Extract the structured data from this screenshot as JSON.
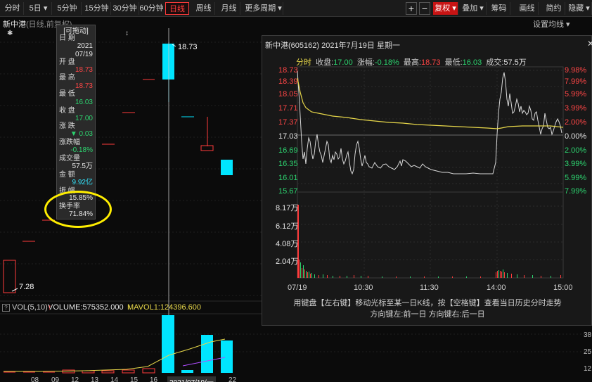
{
  "toolbar": {
    "items": [
      "分时",
      "5日",
      "5分钟",
      "15分钟",
      "30分钟",
      "60分钟",
      "日线",
      "周线",
      "月线",
      "更多周期"
    ],
    "plus": "+",
    "minus": "−",
    "right_items": [
      "复权",
      "叠加",
      "筹码",
      "画线",
      "简约",
      "隐藏"
    ],
    "active_item": "日线"
  },
  "stock": {
    "name": "新中港",
    "subtitle": "(日线,前复权)"
  },
  "setting_label": "设置均线",
  "info_box": {
    "header": "[可拖动]",
    "rows": [
      {
        "label": "日  期",
        "value": "2021\n07/19"
      },
      {
        "label": "开  盘",
        "value": "18.73"
      },
      {
        "label": "最  高",
        "value": "18.73"
      },
      {
        "label": "最  低",
        "value": "16.03"
      },
      {
        "label": "收  盘",
        "value": "17.00"
      },
      {
        "label": "涨  跌",
        "value": "▼ 0.03"
      },
      {
        "label": "涨跌幅",
        "value": "-0.18%"
      },
      {
        "label": "成交量",
        "value": "57.5万"
      },
      {
        "label": "金  额",
        "value": "9.92亿"
      },
      {
        "label": "振  幅",
        "value": "15.85%"
      },
      {
        "label": "换手率",
        "value": "71.84%"
      }
    ]
  },
  "price_labels": {
    "high": "18.73",
    "low": "7.28"
  },
  "marks": {
    "star": "✱",
    "updown": "↕"
  },
  "volume": {
    "title": "VOL(5,10)",
    "volume_text": "VOLUME:575352.000",
    "mavol_text": "MAVOL1:124396.600",
    "ticks": [
      "38",
      "25",
      "12"
    ]
  },
  "date_axis": [
    "08",
    "09",
    "12",
    "13",
    "14",
    "15",
    "16",
    "2021/07/19/一",
    "22"
  ],
  "popup": {
    "title": "新中港(605162) 2021年7月19日 星期一",
    "close": "✕",
    "info": {
      "label": "分时",
      "close_label": "收盘:",
      "close_value": "17.00",
      "chg_label": "涨幅:",
      "chg_value": "-0.18%",
      "high_label": "最高:",
      "high_value": "18.73",
      "low_label": "最低:",
      "low_value": "16.03",
      "vol_label": "成交:",
      "vol_value": "57.5万"
    },
    "left_axis": [
      "18.73",
      "18.39",
      "18.05",
      "17.71",
      "17.37",
      "17.03",
      "16.69",
      "16.35",
      "16.01",
      "15.67"
    ],
    "right_axis": [
      "9.98%",
      "7.99%",
      "5.99%",
      "3.99%",
      "2.00%",
      "0.00%",
      "2.00%",
      "3.99%",
      "5.99%",
      "7.99%"
    ],
    "volume_axis": [
      "8.17万",
      "6.12万",
      "4.08万",
      "2.04万"
    ],
    "time_axis": [
      "07/19",
      "10:30",
      "11:30",
      "14:00",
      "15:00"
    ],
    "hint_line1": "用键盘【左右键】移动光标至某一日K线，按【空格键】查看当日历史分时走势",
    "hint_line2": "方向键左:前一日  方向键右:后一日"
  },
  "colors": {
    "up": "#ff3b3b",
    "down": "#2dd36f",
    "candle_down": "#00e5ff",
    "ma": "#e8d84a",
    "annotation": "#ffee00"
  }
}
